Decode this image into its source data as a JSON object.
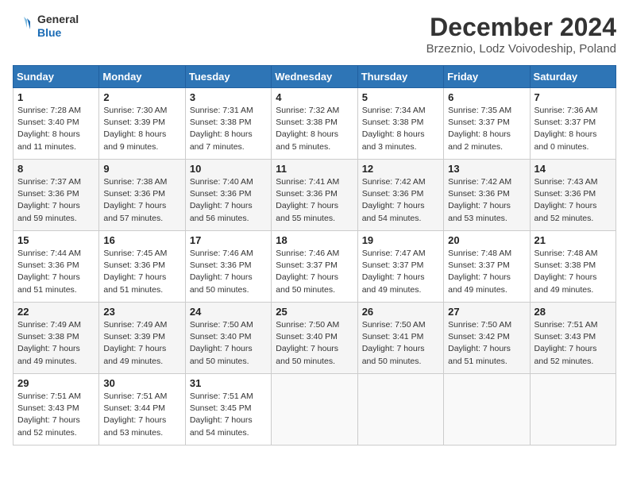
{
  "header": {
    "logo_line1": "General",
    "logo_line2": "Blue",
    "title": "December 2024",
    "subtitle": "Brzeznio, Lodz Voivodeship, Poland"
  },
  "weekdays": [
    "Sunday",
    "Monday",
    "Tuesday",
    "Wednesday",
    "Thursday",
    "Friday",
    "Saturday"
  ],
  "weeks": [
    [
      {
        "day": "1",
        "sunrise": "Sunrise: 7:28 AM",
        "sunset": "Sunset: 3:40 PM",
        "daylight": "Daylight: 8 hours and 11 minutes."
      },
      {
        "day": "2",
        "sunrise": "Sunrise: 7:30 AM",
        "sunset": "Sunset: 3:39 PM",
        "daylight": "Daylight: 8 hours and 9 minutes."
      },
      {
        "day": "3",
        "sunrise": "Sunrise: 7:31 AM",
        "sunset": "Sunset: 3:38 PM",
        "daylight": "Daylight: 8 hours and 7 minutes."
      },
      {
        "day": "4",
        "sunrise": "Sunrise: 7:32 AM",
        "sunset": "Sunset: 3:38 PM",
        "daylight": "Daylight: 8 hours and 5 minutes."
      },
      {
        "day": "5",
        "sunrise": "Sunrise: 7:34 AM",
        "sunset": "Sunset: 3:38 PM",
        "daylight": "Daylight: 8 hours and 3 minutes."
      },
      {
        "day": "6",
        "sunrise": "Sunrise: 7:35 AM",
        "sunset": "Sunset: 3:37 PM",
        "daylight": "Daylight: 8 hours and 2 minutes."
      },
      {
        "day": "7",
        "sunrise": "Sunrise: 7:36 AM",
        "sunset": "Sunset: 3:37 PM",
        "daylight": "Daylight: 8 hours and 0 minutes."
      }
    ],
    [
      {
        "day": "8",
        "sunrise": "Sunrise: 7:37 AM",
        "sunset": "Sunset: 3:36 PM",
        "daylight": "Daylight: 7 hours and 59 minutes."
      },
      {
        "day": "9",
        "sunrise": "Sunrise: 7:38 AM",
        "sunset": "Sunset: 3:36 PM",
        "daylight": "Daylight: 7 hours and 57 minutes."
      },
      {
        "day": "10",
        "sunrise": "Sunrise: 7:40 AM",
        "sunset": "Sunset: 3:36 PM",
        "daylight": "Daylight: 7 hours and 56 minutes."
      },
      {
        "day": "11",
        "sunrise": "Sunrise: 7:41 AM",
        "sunset": "Sunset: 3:36 PM",
        "daylight": "Daylight: 7 hours and 55 minutes."
      },
      {
        "day": "12",
        "sunrise": "Sunrise: 7:42 AM",
        "sunset": "Sunset: 3:36 PM",
        "daylight": "Daylight: 7 hours and 54 minutes."
      },
      {
        "day": "13",
        "sunrise": "Sunrise: 7:42 AM",
        "sunset": "Sunset: 3:36 PM",
        "daylight": "Daylight: 7 hours and 53 minutes."
      },
      {
        "day": "14",
        "sunrise": "Sunrise: 7:43 AM",
        "sunset": "Sunset: 3:36 PM",
        "daylight": "Daylight: 7 hours and 52 minutes."
      }
    ],
    [
      {
        "day": "15",
        "sunrise": "Sunrise: 7:44 AM",
        "sunset": "Sunset: 3:36 PM",
        "daylight": "Daylight: 7 hours and 51 minutes."
      },
      {
        "day": "16",
        "sunrise": "Sunrise: 7:45 AM",
        "sunset": "Sunset: 3:36 PM",
        "daylight": "Daylight: 7 hours and 51 minutes."
      },
      {
        "day": "17",
        "sunrise": "Sunrise: 7:46 AM",
        "sunset": "Sunset: 3:36 PM",
        "daylight": "Daylight: 7 hours and 50 minutes."
      },
      {
        "day": "18",
        "sunrise": "Sunrise: 7:46 AM",
        "sunset": "Sunset: 3:37 PM",
        "daylight": "Daylight: 7 hours and 50 minutes."
      },
      {
        "day": "19",
        "sunrise": "Sunrise: 7:47 AM",
        "sunset": "Sunset: 3:37 PM",
        "daylight": "Daylight: 7 hours and 49 minutes."
      },
      {
        "day": "20",
        "sunrise": "Sunrise: 7:48 AM",
        "sunset": "Sunset: 3:37 PM",
        "daylight": "Daylight: 7 hours and 49 minutes."
      },
      {
        "day": "21",
        "sunrise": "Sunrise: 7:48 AM",
        "sunset": "Sunset: 3:38 PM",
        "daylight": "Daylight: 7 hours and 49 minutes."
      }
    ],
    [
      {
        "day": "22",
        "sunrise": "Sunrise: 7:49 AM",
        "sunset": "Sunset: 3:38 PM",
        "daylight": "Daylight: 7 hours and 49 minutes."
      },
      {
        "day": "23",
        "sunrise": "Sunrise: 7:49 AM",
        "sunset": "Sunset: 3:39 PM",
        "daylight": "Daylight: 7 hours and 49 minutes."
      },
      {
        "day": "24",
        "sunrise": "Sunrise: 7:50 AM",
        "sunset": "Sunset: 3:40 PM",
        "daylight": "Daylight: 7 hours and 50 minutes."
      },
      {
        "day": "25",
        "sunrise": "Sunrise: 7:50 AM",
        "sunset": "Sunset: 3:40 PM",
        "daylight": "Daylight: 7 hours and 50 minutes."
      },
      {
        "day": "26",
        "sunrise": "Sunrise: 7:50 AM",
        "sunset": "Sunset: 3:41 PM",
        "daylight": "Daylight: 7 hours and 50 minutes."
      },
      {
        "day": "27",
        "sunrise": "Sunrise: 7:50 AM",
        "sunset": "Sunset: 3:42 PM",
        "daylight": "Daylight: 7 hours and 51 minutes."
      },
      {
        "day": "28",
        "sunrise": "Sunrise: 7:51 AM",
        "sunset": "Sunset: 3:43 PM",
        "daylight": "Daylight: 7 hours and 52 minutes."
      }
    ],
    [
      {
        "day": "29",
        "sunrise": "Sunrise: 7:51 AM",
        "sunset": "Sunset: 3:43 PM",
        "daylight": "Daylight: 7 hours and 52 minutes."
      },
      {
        "day": "30",
        "sunrise": "Sunrise: 7:51 AM",
        "sunset": "Sunset: 3:44 PM",
        "daylight": "Daylight: 7 hours and 53 minutes."
      },
      {
        "day": "31",
        "sunrise": "Sunrise: 7:51 AM",
        "sunset": "Sunset: 3:45 PM",
        "daylight": "Daylight: 7 hours and 54 minutes."
      },
      null,
      null,
      null,
      null
    ]
  ]
}
